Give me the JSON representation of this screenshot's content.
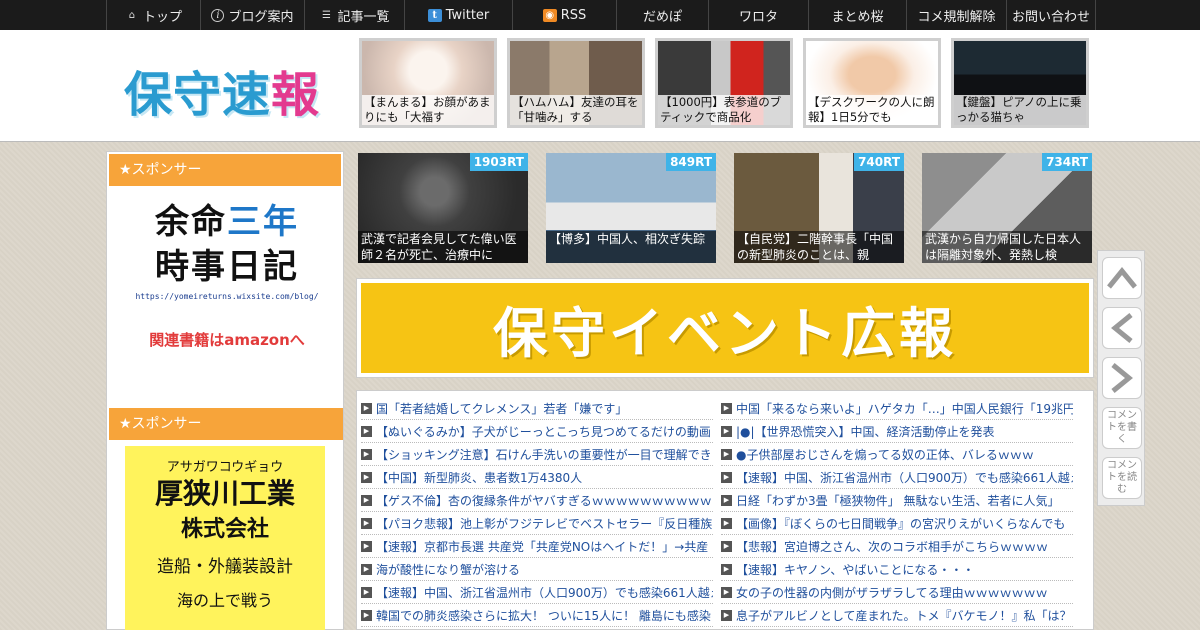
{
  "nav": {
    "items": [
      {
        "label": "トップ",
        "icon": "home-icon"
      },
      {
        "label": "ブログ案内",
        "icon": "info-icon"
      },
      {
        "label": "記事一覧",
        "icon": "list-icon"
      },
      {
        "label": "Twitter",
        "icon": "twitter-icon"
      },
      {
        "label": "RSS",
        "icon": "rss-icon"
      },
      {
        "label": "だめぽ"
      },
      {
        "label": "ワロタ"
      },
      {
        "label": "まとめ桜"
      },
      {
        "label": "コメ規制解除"
      },
      {
        "label": "お問い合わせ"
      }
    ]
  },
  "header": {
    "logo": {
      "part1": "保守速",
      "part2": "報"
    },
    "thumbs": [
      {
        "caption": "【まんまる】お顔があまりにも「大福す"
      },
      {
        "caption": "【ハムハム】友達の耳を「甘噛み」する"
      },
      {
        "caption": "【1000円】表参道のブティックで商品化"
      },
      {
        "caption": "【デスクワークの人に朗報】1日5分でも"
      },
      {
        "caption": "【鍵盤】ピアノの上に乗っかる猫ちゃ"
      }
    ]
  },
  "sidebar": {
    "sponsor1": "★スポンサー",
    "banner1": {
      "line1a": "余命",
      "line1b": "三年",
      "line2": "時事日記",
      "url": "https://yomeireturns.wixsite.com/blog/",
      "amazon": "関連書籍はamazonへ"
    },
    "sponsor2": "★スポンサー",
    "banner2": {
      "kana": "アサガワコウギョウ",
      "company": "厚狭川工業",
      "kk": "株式会社",
      "desc": "造船・外艤装設計",
      "tail": "海の上で戦う"
    }
  },
  "rt_items": [
    {
      "count": "1903RT",
      "caption": "武漢で記者会見してた偉い医師２名が死亡、治療中に"
    },
    {
      "count": "849RT",
      "caption": "【博多】中国人、相次ぎ失踪"
    },
    {
      "count": "740RT",
      "caption": "【自民党】二階幹事長「中国の新型肺炎のことは、親"
    },
    {
      "count": "734RT",
      "caption": "武漢から自力帰国した日本人は隔離対象外、発熱し検"
    }
  ],
  "event_banner": "保守イベント広報",
  "list_left": [
    "国「若者結婚してクレメンス」若者「嫌です」",
    "【ぬいぐるみか】子犬がじーっとこっち見つめてるだけの動画",
    "【ショッキング注意】石けん手洗いの重要性が一目で理解でき",
    "【中国】新型肺炎、患者数1万4380人",
    "【ゲス不倫】杏の復縁条件がヤバすぎるｗｗｗｗｗｗｗｗｗｗ",
    "【パヨク悲報】池上彰がフジテレビでベストセラー『反日種族",
    "【速報】京都市長選 共産党「共産党NOはヘイトだ！」→共産",
    "海が酸性になり蟹が溶ける",
    "【速報】中国、浙江省温州市（人口900万）でも感染661人越え",
    "韓国での肺炎感染さらに拡大！ ついに15人に！ 離島にも感染"
  ],
  "list_right": [
    "中国「来るなら来いよ」ハゲタカ「…」中国人民銀行「19兆円",
    "|●|【世界恐慌突入】中国、経済活動停止を発表",
    "●子供部屋おじさんを煽ってる奴の正体、バレるｗｗｗ",
    "【速報】中国、浙江省温州市（人口900万）でも感染661人越え",
    "日経「わずか3畳「極狭物件」 無駄ない生活、若者に人気」",
    "【画像】『ぼくらの七日間戦争』の宮沢りえがいくらなんでも",
    "【悲報】宮迫博之さん、次のコラボ相手がこちらｗｗｗｗ",
    "【速報】キヤノン、やばいことになる・・・",
    "女の子の性器の内側がザラザラしてる理由ｗｗｗｗｗｗｗ",
    "息子がアルビノとして産まれた。トメ『バケモノ！』私「は？"
  ],
  "controls": {
    "comment_write": "コメントを書く",
    "comment_read": "コメントを読む"
  }
}
